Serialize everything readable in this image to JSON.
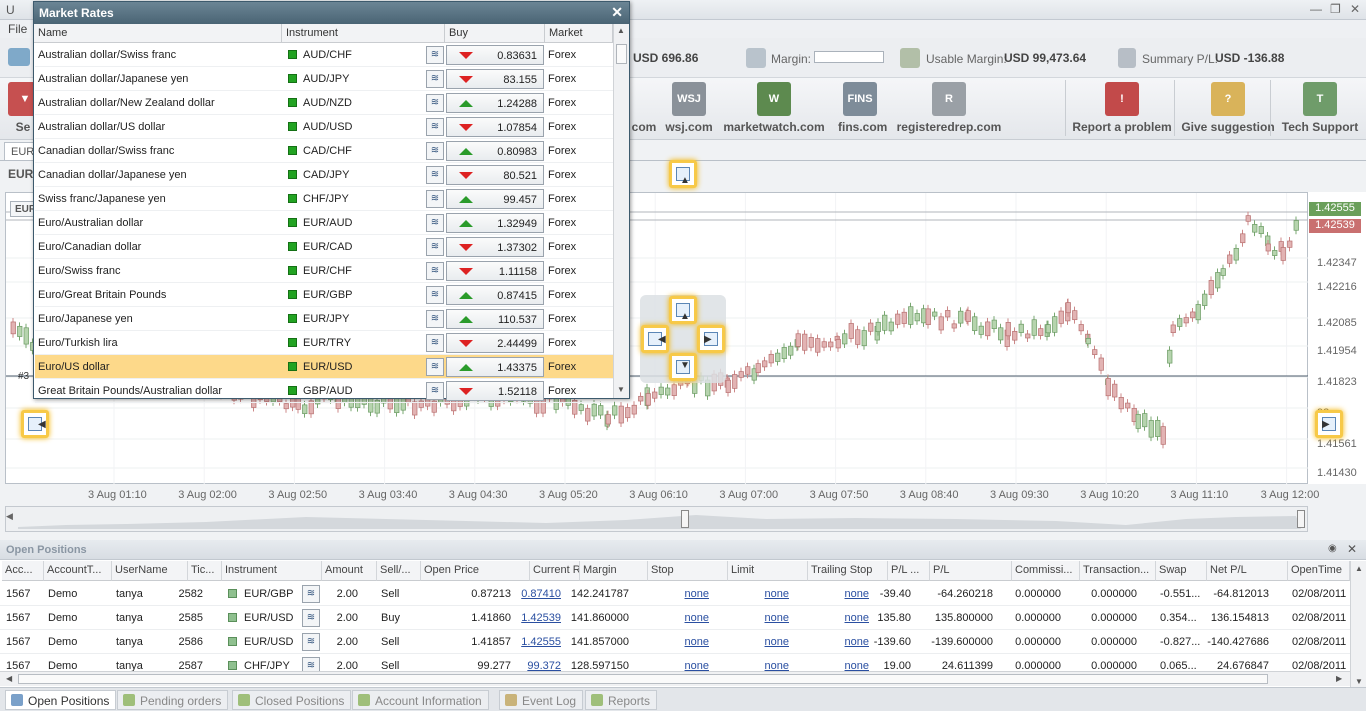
{
  "app": {
    "title": "U",
    "menu_file": "File"
  },
  "account": {
    "balance_val": "USD 696.86",
    "margin_lbl": "Margin:",
    "usable_lbl": "Usable Margin:",
    "usable_val": "USD 99,473.64",
    "summary_lbl": "Summary P/L:",
    "summary_val": "USD -136.88"
  },
  "toolbar": {
    "partial_left": "Se",
    "partial_com": "com",
    "items": [
      {
        "label": "wsj.com",
        "icon": "WSJ",
        "color": "#8a9199"
      },
      {
        "label": "marketwatch.com",
        "icon": "W",
        "color": "#5d8a4f"
      },
      {
        "label": "fins.com",
        "icon": "FINS",
        "color": "#7e8c99"
      },
      {
        "label": "registeredrep.com",
        "icon": "R",
        "color": "#9aa0a6"
      },
      {
        "label": "Report a problem",
        "icon": "!",
        "color": "#c24a4a"
      },
      {
        "label": "Give suggestion",
        "icon": "?",
        "color": "#d9b35a"
      },
      {
        "label": "Tech Support",
        "icon": "T",
        "color": "#6f9c6a"
      }
    ]
  },
  "chart": {
    "tab_label": "EUR",
    "symbol_label": "EUR",
    "inner_label": "EUR",
    "marker": "#3",
    "price_ask": "1.42555",
    "price_bid": "1.42539",
    "y_ticks": [
      "1.42347",
      "1.42216",
      "1.42085",
      "1.41954",
      "1.41823",
      "92",
      "1.41561",
      "1.41430"
    ],
    "x_ticks": [
      "3 Aug 01:10",
      "3 Aug 02:00",
      "3 Aug 02:50",
      "3 Aug 03:40",
      "3 Aug 04:30",
      "3 Aug 05:20",
      "3 Aug 06:10",
      "3 Aug 07:00",
      "3 Aug 07:50",
      "3 Aug 08:40",
      "3 Aug 09:30",
      "3 Aug 10:20",
      "3 Aug 11:10",
      "3 Aug 12:00"
    ]
  },
  "market_rates": {
    "title": "Market Rates",
    "columns": [
      "Name",
      "Instrument",
      "Buy",
      "Market"
    ],
    "rows": [
      {
        "name": "Australian dollar/Swiss franc",
        "instrument": "AUD/CHF",
        "buy": "0.83631",
        "dir": "down",
        "market": "Forex"
      },
      {
        "name": "Australian dollar/Japanese yen",
        "instrument": "AUD/JPY",
        "buy": "83.155",
        "dir": "down",
        "market": "Forex"
      },
      {
        "name": "Australian dollar/New Zealand dollar",
        "instrument": "AUD/NZD",
        "buy": "1.24288",
        "dir": "up",
        "market": "Forex"
      },
      {
        "name": "Australian dollar/US dollar",
        "instrument": "AUD/USD",
        "buy": "1.07854",
        "dir": "down",
        "market": "Forex"
      },
      {
        "name": "Canadian dollar/Swiss franc",
        "instrument": "CAD/CHF",
        "buy": "0.80983",
        "dir": "up",
        "market": "Forex"
      },
      {
        "name": "Canadian dollar/Japanese yen",
        "instrument": "CAD/JPY",
        "buy": "80.521",
        "dir": "down",
        "market": "Forex"
      },
      {
        "name": "Swiss franc/Japanese yen",
        "instrument": "CHF/JPY",
        "buy": "99.457",
        "dir": "up",
        "market": "Forex"
      },
      {
        "name": "Euro/Australian dollar",
        "instrument": "EUR/AUD",
        "buy": "1.32949",
        "dir": "up",
        "market": "Forex"
      },
      {
        "name": "Euro/Canadian dollar",
        "instrument": "EUR/CAD",
        "buy": "1.37302",
        "dir": "down",
        "market": "Forex"
      },
      {
        "name": "Euro/Swiss franc",
        "instrument": "EUR/CHF",
        "buy": "1.11158",
        "dir": "down",
        "market": "Forex"
      },
      {
        "name": "Euro/Great Britain Pounds",
        "instrument": "EUR/GBP",
        "buy": "0.87415",
        "dir": "up",
        "market": "Forex"
      },
      {
        "name": "Euro/Japanese yen",
        "instrument": "EUR/JPY",
        "buy": "110.537",
        "dir": "up",
        "market": "Forex"
      },
      {
        "name": "Euro/Turkish lira",
        "instrument": "EUR/TRY",
        "buy": "2.44499",
        "dir": "down",
        "market": "Forex"
      },
      {
        "name": "Euro/US dollar",
        "instrument": "EUR/USD",
        "buy": "1.43375",
        "dir": "up",
        "market": "Forex",
        "selected": true
      },
      {
        "name": "Great Britain Pounds/Australian dollar",
        "instrument": "GBP/AUD",
        "buy": "1.52118",
        "dir": "down",
        "market": "Forex"
      }
    ]
  },
  "open_positions": {
    "title": "Open Positions",
    "columns": [
      "Acc...",
      "AccountT...",
      "UserName",
      "Tic...",
      "Instrument",
      "Amount",
      "Sell/...",
      "Open Price",
      "Current Rate",
      "Margin",
      "Stop",
      "Limit",
      "Trailing Stop",
      "P/L ...",
      "P/L",
      "Commissi...",
      "Transaction...",
      "Swap",
      "Net P/L",
      "OpenTime"
    ],
    "rows": [
      [
        "1567",
        "Demo",
        "tanya",
        "2582",
        "EUR/GBP",
        "2.00",
        "Sell",
        "0.87213",
        "0.87410",
        "142.241787",
        "none",
        "none",
        "none",
        "-39.40",
        "-64.260218",
        "0.000000",
        "0.000000",
        "-0.551...",
        "-64.812013",
        "02/08/2011"
      ],
      [
        "1567",
        "Demo",
        "tanya",
        "2585",
        "EUR/USD",
        "2.00",
        "Buy",
        "1.41860",
        "1.42539",
        "141.860000",
        "none",
        "none",
        "none",
        "135.80",
        "135.800000",
        "0.000000",
        "0.000000",
        "0.354...",
        "136.154813",
        "02/08/2011"
      ],
      [
        "1567",
        "Demo",
        "tanya",
        "2586",
        "EUR/USD",
        "2.00",
        "Sell",
        "1.41857",
        "1.42555",
        "141.857000",
        "none",
        "none",
        "none",
        "-139.60",
        "-139.600000",
        "0.000000",
        "0.000000",
        "-0.827...",
        "-140.427686",
        "02/08/2011"
      ],
      [
        "1567",
        "Demo",
        "tanya",
        "2587",
        "CHF/JPY",
        "2.00",
        "Sell",
        "99.277",
        "99.372",
        "128.597150",
        "none",
        "none",
        "none",
        "19.00",
        "24.611399",
        "0.000000",
        "0.000000",
        "0.065...",
        "24.676847",
        "02/08/2011"
      ]
    ]
  },
  "tabs": [
    "Open Positions",
    "Pending orders",
    "Closed Positions",
    "Account Information",
    "Event Log",
    "Reports"
  ]
}
